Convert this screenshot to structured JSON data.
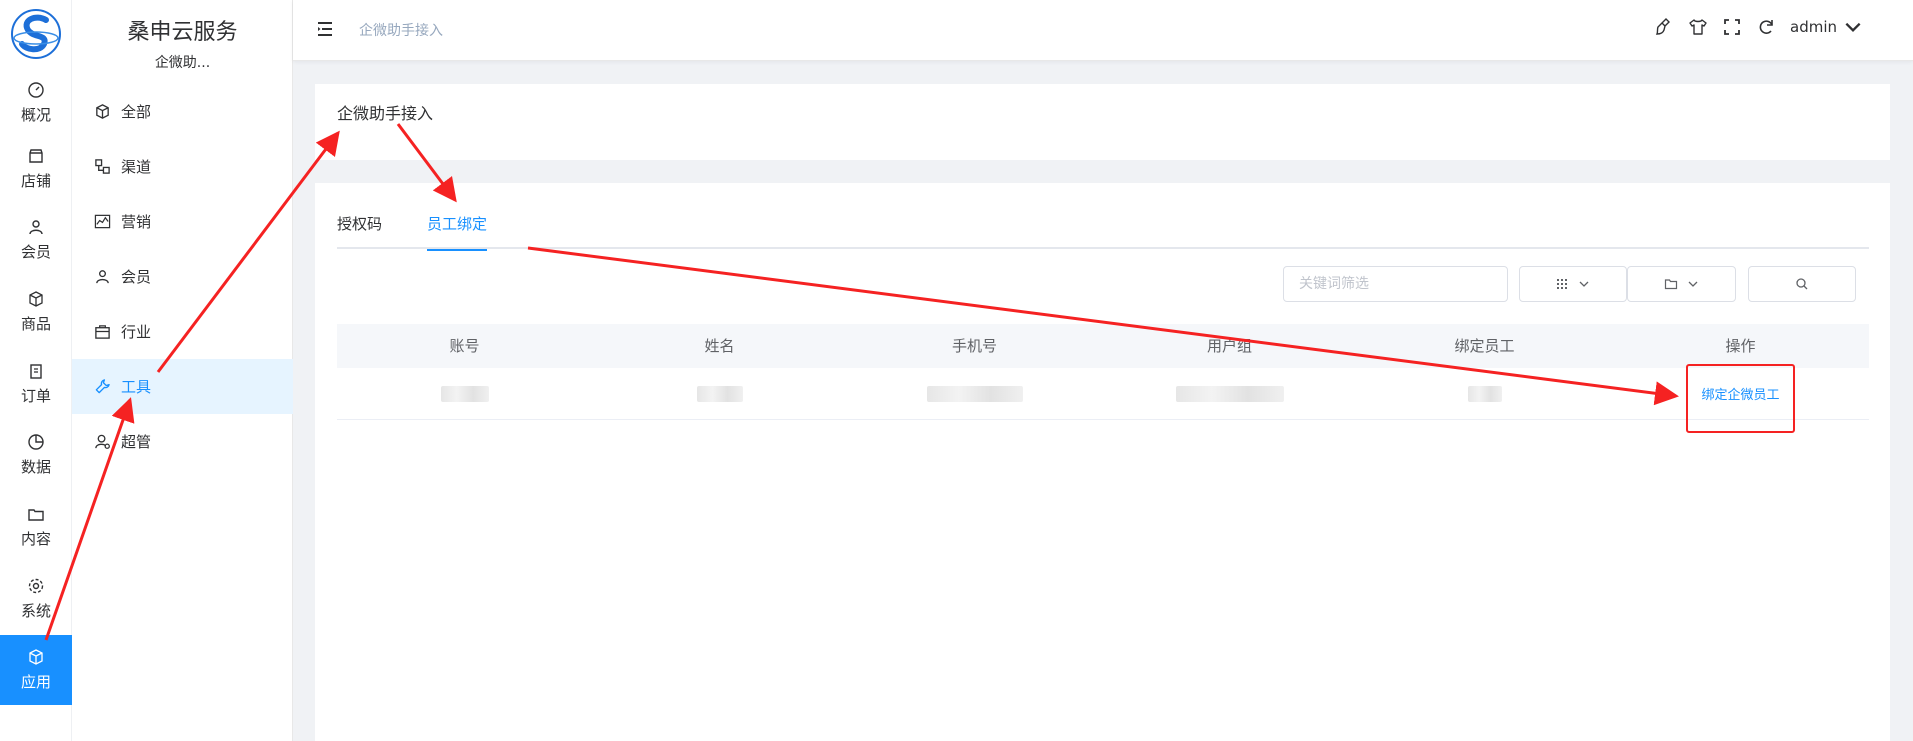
{
  "app": {
    "logo_icon": "brand-logo-s",
    "brand_title": "桑申云服务",
    "brand_subtitle": "企微助..."
  },
  "rail": {
    "items": [
      {
        "label": "概况",
        "icon": "dashboard-icon"
      },
      {
        "label": "店铺",
        "icon": "store-icon"
      },
      {
        "label": "会员",
        "icon": "user-icon"
      },
      {
        "label": "商品",
        "icon": "box-icon"
      },
      {
        "label": "订单",
        "icon": "clipboard-icon"
      },
      {
        "label": "数据",
        "icon": "pie-chart-icon"
      },
      {
        "label": "内容",
        "icon": "folder-icon"
      },
      {
        "label": "系统",
        "icon": "gear-icon"
      },
      {
        "label": "应用",
        "icon": "cube-icon",
        "active": true
      }
    ]
  },
  "sidebar": {
    "items": [
      {
        "label": "全部",
        "icon": "cube-icon"
      },
      {
        "label": "渠道",
        "icon": "channel-icon"
      },
      {
        "label": "营销",
        "icon": "trend-icon"
      },
      {
        "label": "会员",
        "icon": "user-icon"
      },
      {
        "label": "行业",
        "icon": "briefcase-icon"
      },
      {
        "label": "工具",
        "icon": "wrench-icon",
        "active": true
      },
      {
        "label": "超管",
        "icon": "admin-user-icon"
      }
    ]
  },
  "header": {
    "breadcrumb": "企微助手接入",
    "user_name": "admin",
    "tool_icons": [
      "brush-icon",
      "shirt-icon",
      "fullscreen-icon",
      "refresh-icon"
    ]
  },
  "page": {
    "title": "企微助手接入",
    "tabs": [
      {
        "label": "授权码"
      },
      {
        "label": "员工绑定",
        "active": true
      }
    ],
    "filters": {
      "keyword_placeholder": "关键词筛选",
      "grid_icon": "grid-icon",
      "folder_icon": "folder-icon",
      "search_icon": "search-icon"
    },
    "table": {
      "columns": [
        "账号",
        "姓名",
        "手机号",
        "用户组",
        "绑定员工",
        "操作"
      ],
      "rows": [
        {
          "action": "绑定企微员工"
        }
      ]
    }
  },
  "colors": {
    "accent": "#1890ff",
    "annotation": "#f52222"
  }
}
